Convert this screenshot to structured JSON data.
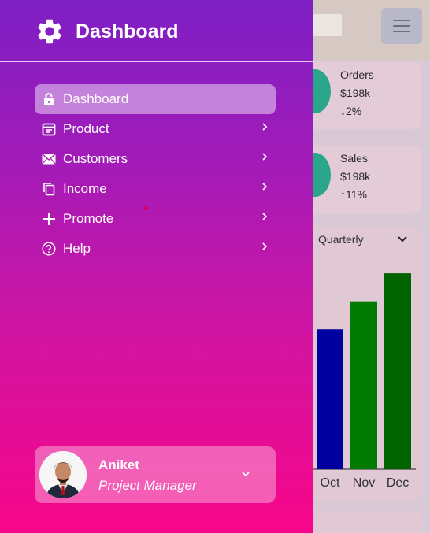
{
  "sidebar": {
    "brand_title": "Dashboard",
    "menu": [
      {
        "label": "Dashboard",
        "icon": "lock-icon",
        "active": true
      },
      {
        "label": "Product",
        "icon": "calendar-icon",
        "has_submenu": true
      },
      {
        "label": "Customers",
        "icon": "mail-icon",
        "has_submenu": true
      },
      {
        "label": "Income",
        "icon": "copy-icon",
        "has_submenu": true
      },
      {
        "label": "Promote",
        "icon": "plus-icon",
        "has_submenu": true
      },
      {
        "label": "Help",
        "icon": "question-icon",
        "has_submenu": true
      }
    ],
    "profile": {
      "name": "Aniket",
      "role": "Project Manager"
    }
  },
  "main": {
    "stats": [
      {
        "title": "Orders",
        "value": "$198k",
        "change": "2%",
        "direction": "down"
      },
      {
        "title": "Sales",
        "value": "$198k",
        "change": "11%",
        "direction": "up"
      }
    ],
    "period_select": "Quarterly",
    "chart_data": {
      "type": "bar",
      "categories": [
        "Oct",
        "Nov",
        "Dec"
      ],
      "values": [
        160,
        192,
        224
      ],
      "colors": [
        "#0000a0",
        "#007a00",
        "#006400"
      ]
    }
  },
  "colors": {
    "sidebar_top": "#7e1fc4",
    "sidebar_bottom": "#f8068a",
    "stat_icon": "#2aa68a"
  }
}
